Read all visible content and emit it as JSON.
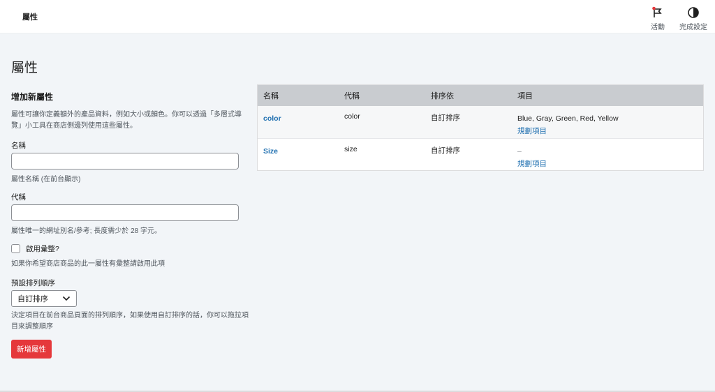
{
  "topbar": {
    "title": "屬性",
    "activity_label": "活動",
    "finish_label": "完成設定"
  },
  "page": {
    "heading": "屬性"
  },
  "form": {
    "heading": "增加新屬性",
    "intro": "屬性可讓你定義額外的產品資料，例如大小或顏色。你可以透過「多層式導覽」小工具在商店側邊列使用這些屬性。",
    "name_label": "名稱",
    "name_value": "",
    "name_hint": "屬性名稱 (在前台顯示)",
    "slug_label": "代稱",
    "slug_value": "",
    "slug_hint": "屬性唯一的網址別名/參考; 長度需少於 28 字元。",
    "archive_label": "啟用彙整?",
    "archive_hint": "如果你希望商店商品的此一屬性有彙整請啟用此項",
    "sort_label": "預設排列順序",
    "sort_value": "自訂排序",
    "sort_hint": "決定項目在前台商品頁面的排列順序，如果使用自訂排序的話，你可以拖拉項目來調整順序",
    "submit_label": "新增屬性"
  },
  "table": {
    "headers": [
      "名稱",
      "代稱",
      "排序依",
      "項目"
    ],
    "rows": [
      {
        "name": "color",
        "slug": "color",
        "order": "自訂排序",
        "terms": "Blue, Gray, Green, Red, Yellow",
        "action": "規劃項目"
      },
      {
        "name": "Size",
        "slug": "size",
        "order": "自訂排序",
        "terms": "–",
        "action": "規劃項目"
      }
    ]
  },
  "colors": {
    "accent": "#2271b1",
    "button": "#e5383b",
    "notice_dot": "#e5383b"
  }
}
